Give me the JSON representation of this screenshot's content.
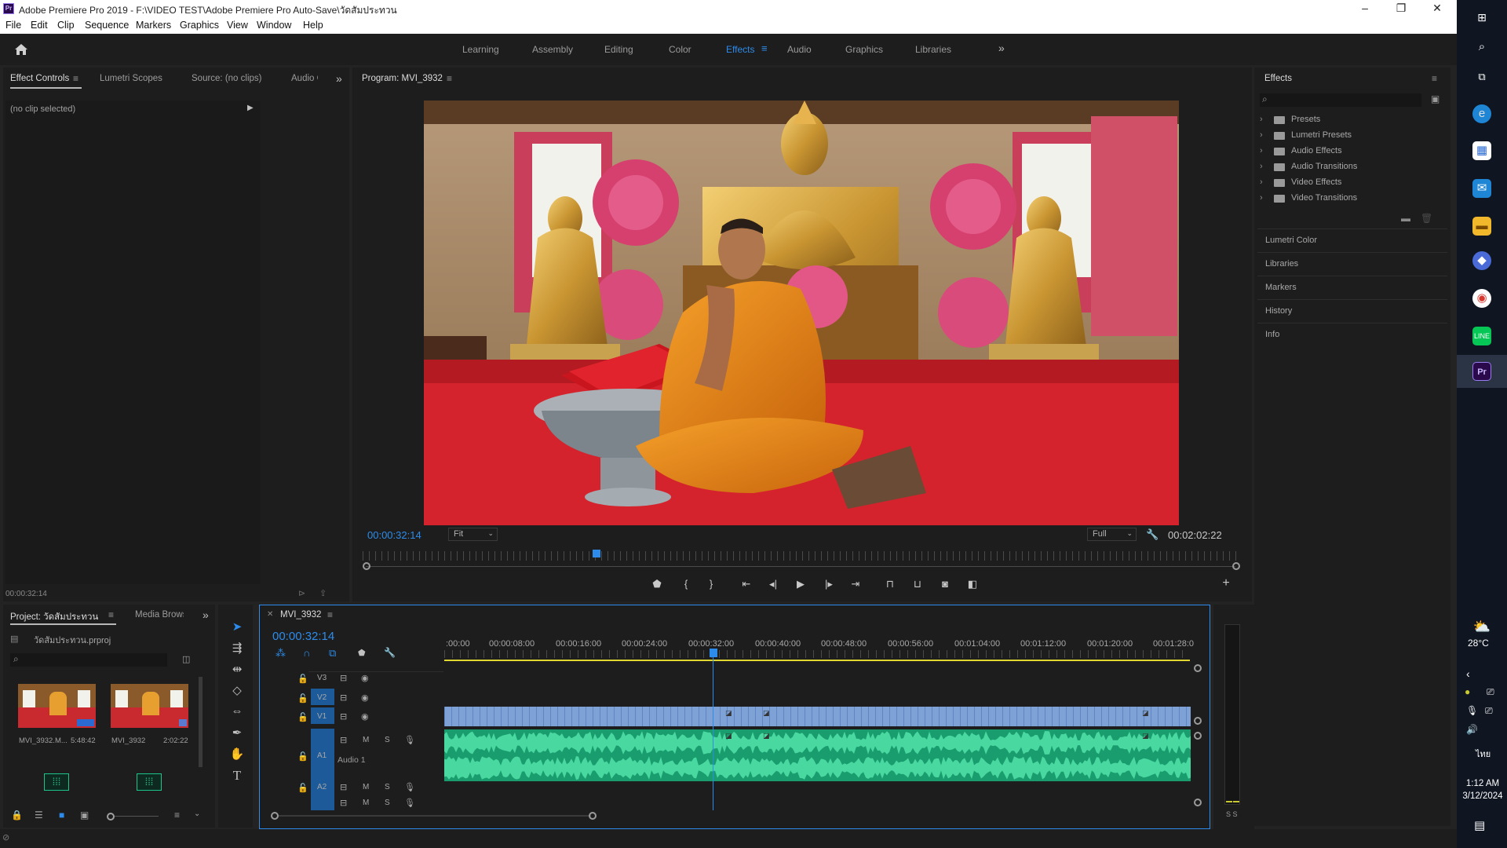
{
  "window": {
    "title": "Adobe Premiere Pro 2019 - F:\\VIDEO TEST\\Adobe Premiere Pro Auto-Save\\วัดสัมประทวน",
    "app_icon": "Pr",
    "controls": [
      "–",
      "❐",
      "✕"
    ]
  },
  "menu": [
    "File",
    "Edit",
    "Clip",
    "Sequence",
    "Markers",
    "Graphics",
    "View",
    "Window",
    "Help"
  ],
  "workspaces": {
    "items": [
      "Learning",
      "Assembly",
      "Editing",
      "Color",
      "Effects",
      "Audio",
      "Graphics",
      "Libraries"
    ],
    "active": "Effects",
    "more": "»"
  },
  "source_panel": {
    "tabs": [
      "Effect Controls",
      "Lumetri Scopes",
      "Source: (no clips)",
      "Audio C"
    ],
    "active_tab": "Effect Controls",
    "no_clip": "(no clip selected)",
    "timecode": "00:00:32:14"
  },
  "program": {
    "tab": "Program: MVI_3932",
    "timecode": "00:00:32:14",
    "fit": "Fit",
    "quality": "Full",
    "duration": "00:02:02:22",
    "playhead_fraction": 0.265
  },
  "effects_panel": {
    "title": "Effects",
    "search_placeholder": "",
    "folders": [
      "Presets",
      "Lumetri Presets",
      "Audio Effects",
      "Audio Transitions",
      "Video Effects",
      "Video Transitions"
    ],
    "sections": [
      "Lumetri Color",
      "Libraries",
      "Markers",
      "History",
      "Info"
    ]
  },
  "project": {
    "tabs": [
      "Project: วัดสัมประทวน",
      "Media Brows"
    ],
    "file": "วัดสัมประทวน.prproj",
    "items": [
      {
        "name": "MVI_3932.M...",
        "duration": "5:48:42"
      },
      {
        "name": "MVI_3932",
        "duration": "2:02:22"
      }
    ]
  },
  "timeline": {
    "tab": "MVI_3932",
    "timecode": "00:00:32:14",
    "ruler": [
      ":00:00",
      "00:00:08:00",
      "00:00:16:00",
      "00:00:24:00",
      "00:00:32:00",
      "00:00:40:00",
      "00:00:48:00",
      "00:00:56:00",
      "00:01:04:00",
      "00:01:12:00",
      "00:01:20:00",
      "00:01:28:0"
    ],
    "video_tracks": [
      "V3",
      "V2",
      "V1"
    ],
    "audio_tracks": [
      "A1",
      "A2"
    ],
    "audio_name": "Audio 1",
    "track_buttons": {
      "mute": "M",
      "solo": "S"
    },
    "meter_label": "S S"
  },
  "taskbar": {
    "weather": "28°C",
    "time": "1:12 AM",
    "date": "3/12/2024",
    "lang": "ไทย"
  }
}
